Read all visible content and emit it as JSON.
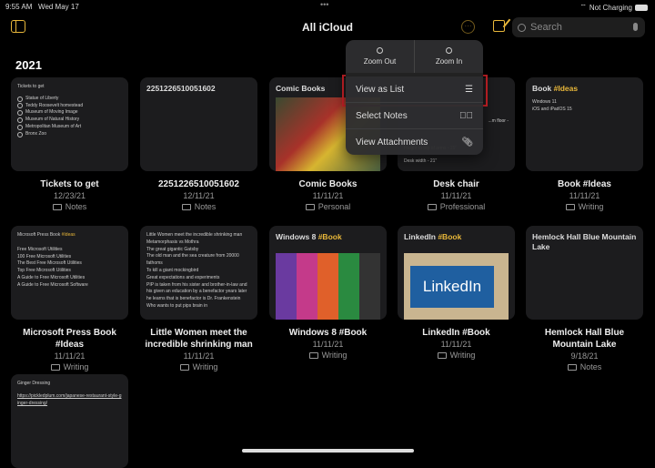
{
  "status": {
    "time": "9:55 AM",
    "date": "Wed May 17",
    "battery": "Not Charging"
  },
  "nav": {
    "title": "All iCloud",
    "search_placeholder": "Search"
  },
  "section": "2021",
  "notes": [
    {
      "title": "Tickets to get",
      "date": "12/23/21",
      "folder": "Notes",
      "preview_title": "Tickets to get",
      "checklist": [
        "Statue of Liberty",
        "Teddy Roosevelt homestead",
        "Museum of Moving Image",
        "Museum of Natural History",
        "Metropolitan Museum of Art",
        "Bronx Zoo"
      ]
    },
    {
      "title": "2251226510051602",
      "date": "12/11/21",
      "folder": "Notes",
      "preview_title": "2251226510051602"
    },
    {
      "title": "Comic Books",
      "date": "11/11/21",
      "folder": "Personal",
      "preview_title": "Comic Books"
    },
    {
      "title": "Desk chair",
      "date": "11/11/21",
      "folder": "Professional",
      "preview_lines": [
        "...m floor -",
        "Height to top of arms - 25\"",
        "Desk width - 21\""
      ]
    },
    {
      "title": "Book #Ideas",
      "date": "11/11/21",
      "folder": "Writing",
      "preview_title": "Book",
      "preview_tag": "#Ideas",
      "preview_lines": [
        "Windows 11",
        "iOS and iPadOS 15"
      ]
    },
    {
      "title": "Microsoft Press Book #Ideas",
      "date": "11/11/21",
      "folder": "Writing",
      "preview_title": "Microsoft Press Book",
      "preview_tag": "#Ideas",
      "preview_lines": [
        "Free Microsoft Utilities",
        "100 Free Microsoft Utilities",
        "The Best Free Microsoft Utilities",
        "Top Free Microsoft Utilities",
        "A Guide to Free Microsoft Utilities",
        "A Guide to Free Microsoft Software"
      ]
    },
    {
      "title": "Little Women meet the incredible shrinking man",
      "date": "11/11/21",
      "folder": "Writing",
      "preview_lines": [
        "Little Women meet the incredible shrinking man",
        "Metamorphasis vs Mothra",
        "The great gigantic Gatsby",
        "The old man and the sea creature from 20000 fathoms",
        "To kill a giant mockingbird",
        "Great expectations and experiments",
        "PIP is taken from his sister and brother-in-law and his given an education by a benefactor years later he learns that is benefactor is Dr. Frankenstein Who wants to put pips brain in"
      ]
    },
    {
      "title": "Windows 8 #Book",
      "date": "11/11/21",
      "folder": "Writing",
      "preview_title": "Windows 8",
      "preview_tag": "#Book"
    },
    {
      "title": "LinkedIn #Book",
      "date": "11/11/21",
      "folder": "Writing",
      "preview_title": "LinkedIn",
      "preview_tag": "#Book",
      "image_text": "LinkedIn"
    },
    {
      "title": "Hemlock Hall Blue Mountain Lake",
      "date": "9/18/21",
      "folder": "Notes",
      "preview_title": "Hemlock Hall Blue Mountain Lake"
    },
    {
      "preview_title": "Ginger Dressing",
      "preview_link": "https://pickledplum.com/japanese-restaurant-style-ginger-dressing/"
    }
  ],
  "menu": {
    "zoom_out": "Zoom Out",
    "zoom_in": "Zoom In",
    "view_as_list": "View as List",
    "select_notes": "Select Notes",
    "view_attachments": "View Attachments"
  },
  "colors": {
    "accent": "#e8b73a",
    "highlight": "#d8232a"
  }
}
